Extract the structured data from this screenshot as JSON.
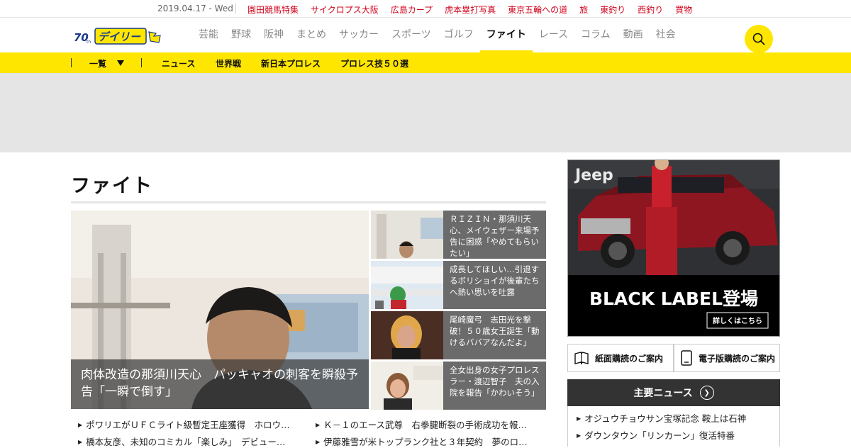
{
  "topbar": {
    "date": "2019.04.17 - Wed",
    "links": [
      "園田競馬特集",
      "サイクロプス大阪",
      "広島カープ",
      "虎本塁打写真",
      "東京五輪への道",
      "旅",
      "東釣り",
      "西釣り",
      "買物"
    ]
  },
  "logo": {
    "label": "デイリー",
    "badge": "70th"
  },
  "nav": {
    "items": [
      "芸能",
      "野球",
      "阪神",
      "まとめ",
      "サッカー",
      "スポーツ",
      "ゴルフ",
      "ファイト",
      "レース",
      "コラム",
      "動画",
      "社会"
    ],
    "active": "ファイト"
  },
  "subnav": {
    "list_label": "一覧",
    "items": [
      "ニュース",
      "世界戦",
      "新日本プロレス",
      "プロレス技５０選"
    ]
  },
  "page": {
    "title": "ファイト"
  },
  "main_story": {
    "caption": "肉体改造の那須川天心　パッキャオの刺客を瞬殺予告「一瞬で倒す」"
  },
  "side_stories": [
    {
      "text": "ＲＩＺＩＮ・那須川天心、メイウェザー来場予告に困惑「やめてもらいたい」"
    },
    {
      "text": "成長してほしい…引退するボリショイが後輩たちへ熱い思いを吐露"
    },
    {
      "text": "尾崎魔弓　志田光を撃破！５０歳女王誕生「動けるババアなんだよ」"
    },
    {
      "text": "全女出身の女子プロレスラー・渡辺智子　夫の入院を報告「かわいそう」"
    }
  ],
  "headlines": [
    "ポワリエがＵＦＣライト級暫定王座獲得　ホロウ…",
    "Ｋ－１のエース武尊　右拳腱断裂の手術成功を報…",
    "橋本友彦、未知のコミカル「楽しみ」　デビュー…",
    "伊藤雅雪が米トップランク社と３年契約　夢のロ…"
  ],
  "ad": {
    "brand": "Jeep",
    "headline": "BLACK LABEL登場",
    "cta": "詳しくはこちら"
  },
  "subscribe": {
    "paper": "紙面購読のご案内",
    "digital": "電子版購読のご案内"
  },
  "major_news": {
    "title": "主要ニュース",
    "items": [
      "オジュウチョウサン宝塚記念 鞍上は石神",
      "ダウンタウン「リンカーン」復活特番"
    ]
  },
  "colors": {
    "brand_yellow": "#ffe600",
    "link_red": "#d0021b",
    "dark_bar": "#333333"
  },
  "icons": [
    "search-icon",
    "chevron-down-icon",
    "book-icon",
    "tablet-icon",
    "arrow-right-icon"
  ]
}
